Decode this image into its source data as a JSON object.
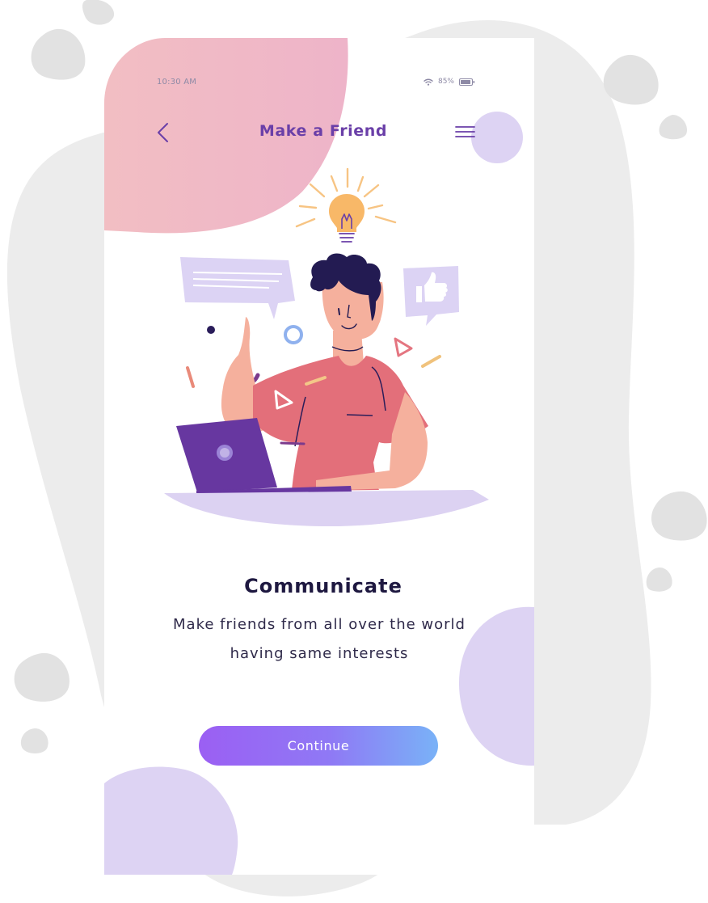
{
  "status_bar": {
    "time": "10:30 AM",
    "battery": "85%"
  },
  "header": {
    "title": "Make a Friend",
    "back_icon": "chevron-left-icon",
    "menu_icon": "hamburger-menu-icon"
  },
  "onboarding": {
    "headline": "Communicate",
    "subtitle": "Make friends from all over the world having same interests",
    "continue_label": "Continue"
  },
  "colors": {
    "accent_purple": "#6a3fa8",
    "button_gradient_start": "#9b5ff3",
    "button_gradient_end": "#79b2f7",
    "blob_pink": "#efb8c8",
    "blob_lavender": "#ddd3f3",
    "backdrop_gray": "#ececec"
  }
}
